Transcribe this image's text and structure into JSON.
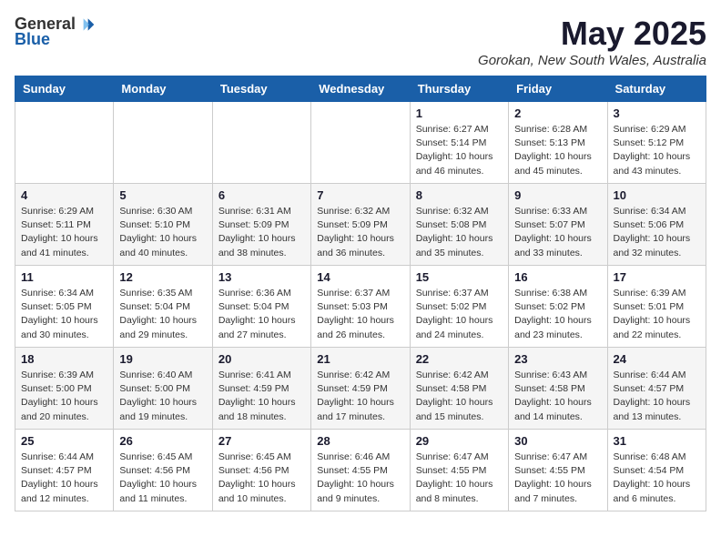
{
  "logo": {
    "general": "General",
    "blue": "Blue"
  },
  "title": "May 2025",
  "location": "Gorokan, New South Wales, Australia",
  "weekdays": [
    "Sunday",
    "Monday",
    "Tuesday",
    "Wednesday",
    "Thursday",
    "Friday",
    "Saturday"
  ],
  "weeks": [
    [
      {
        "day": "",
        "info": ""
      },
      {
        "day": "",
        "info": ""
      },
      {
        "day": "",
        "info": ""
      },
      {
        "day": "",
        "info": ""
      },
      {
        "day": "1",
        "info": "Sunrise: 6:27 AM\nSunset: 5:14 PM\nDaylight: 10 hours\nand 46 minutes."
      },
      {
        "day": "2",
        "info": "Sunrise: 6:28 AM\nSunset: 5:13 PM\nDaylight: 10 hours\nand 45 minutes."
      },
      {
        "day": "3",
        "info": "Sunrise: 6:29 AM\nSunset: 5:12 PM\nDaylight: 10 hours\nand 43 minutes."
      }
    ],
    [
      {
        "day": "4",
        "info": "Sunrise: 6:29 AM\nSunset: 5:11 PM\nDaylight: 10 hours\nand 41 minutes."
      },
      {
        "day": "5",
        "info": "Sunrise: 6:30 AM\nSunset: 5:10 PM\nDaylight: 10 hours\nand 40 minutes."
      },
      {
        "day": "6",
        "info": "Sunrise: 6:31 AM\nSunset: 5:09 PM\nDaylight: 10 hours\nand 38 minutes."
      },
      {
        "day": "7",
        "info": "Sunrise: 6:32 AM\nSunset: 5:09 PM\nDaylight: 10 hours\nand 36 minutes."
      },
      {
        "day": "8",
        "info": "Sunrise: 6:32 AM\nSunset: 5:08 PM\nDaylight: 10 hours\nand 35 minutes."
      },
      {
        "day": "9",
        "info": "Sunrise: 6:33 AM\nSunset: 5:07 PM\nDaylight: 10 hours\nand 33 minutes."
      },
      {
        "day": "10",
        "info": "Sunrise: 6:34 AM\nSunset: 5:06 PM\nDaylight: 10 hours\nand 32 minutes."
      }
    ],
    [
      {
        "day": "11",
        "info": "Sunrise: 6:34 AM\nSunset: 5:05 PM\nDaylight: 10 hours\nand 30 minutes."
      },
      {
        "day": "12",
        "info": "Sunrise: 6:35 AM\nSunset: 5:04 PM\nDaylight: 10 hours\nand 29 minutes."
      },
      {
        "day": "13",
        "info": "Sunrise: 6:36 AM\nSunset: 5:04 PM\nDaylight: 10 hours\nand 27 minutes."
      },
      {
        "day": "14",
        "info": "Sunrise: 6:37 AM\nSunset: 5:03 PM\nDaylight: 10 hours\nand 26 minutes."
      },
      {
        "day": "15",
        "info": "Sunrise: 6:37 AM\nSunset: 5:02 PM\nDaylight: 10 hours\nand 24 minutes."
      },
      {
        "day": "16",
        "info": "Sunrise: 6:38 AM\nSunset: 5:02 PM\nDaylight: 10 hours\nand 23 minutes."
      },
      {
        "day": "17",
        "info": "Sunrise: 6:39 AM\nSunset: 5:01 PM\nDaylight: 10 hours\nand 22 minutes."
      }
    ],
    [
      {
        "day": "18",
        "info": "Sunrise: 6:39 AM\nSunset: 5:00 PM\nDaylight: 10 hours\nand 20 minutes."
      },
      {
        "day": "19",
        "info": "Sunrise: 6:40 AM\nSunset: 5:00 PM\nDaylight: 10 hours\nand 19 minutes."
      },
      {
        "day": "20",
        "info": "Sunrise: 6:41 AM\nSunset: 4:59 PM\nDaylight: 10 hours\nand 18 minutes."
      },
      {
        "day": "21",
        "info": "Sunrise: 6:42 AM\nSunset: 4:59 PM\nDaylight: 10 hours\nand 17 minutes."
      },
      {
        "day": "22",
        "info": "Sunrise: 6:42 AM\nSunset: 4:58 PM\nDaylight: 10 hours\nand 15 minutes."
      },
      {
        "day": "23",
        "info": "Sunrise: 6:43 AM\nSunset: 4:58 PM\nDaylight: 10 hours\nand 14 minutes."
      },
      {
        "day": "24",
        "info": "Sunrise: 6:44 AM\nSunset: 4:57 PM\nDaylight: 10 hours\nand 13 minutes."
      }
    ],
    [
      {
        "day": "25",
        "info": "Sunrise: 6:44 AM\nSunset: 4:57 PM\nDaylight: 10 hours\nand 12 minutes."
      },
      {
        "day": "26",
        "info": "Sunrise: 6:45 AM\nSunset: 4:56 PM\nDaylight: 10 hours\nand 11 minutes."
      },
      {
        "day": "27",
        "info": "Sunrise: 6:45 AM\nSunset: 4:56 PM\nDaylight: 10 hours\nand 10 minutes."
      },
      {
        "day": "28",
        "info": "Sunrise: 6:46 AM\nSunset: 4:55 PM\nDaylight: 10 hours\nand 9 minutes."
      },
      {
        "day": "29",
        "info": "Sunrise: 6:47 AM\nSunset: 4:55 PM\nDaylight: 10 hours\nand 8 minutes."
      },
      {
        "day": "30",
        "info": "Sunrise: 6:47 AM\nSunset: 4:55 PM\nDaylight: 10 hours\nand 7 minutes."
      },
      {
        "day": "31",
        "info": "Sunrise: 6:48 AM\nSunset: 4:54 PM\nDaylight: 10 hours\nand 6 minutes."
      }
    ]
  ]
}
